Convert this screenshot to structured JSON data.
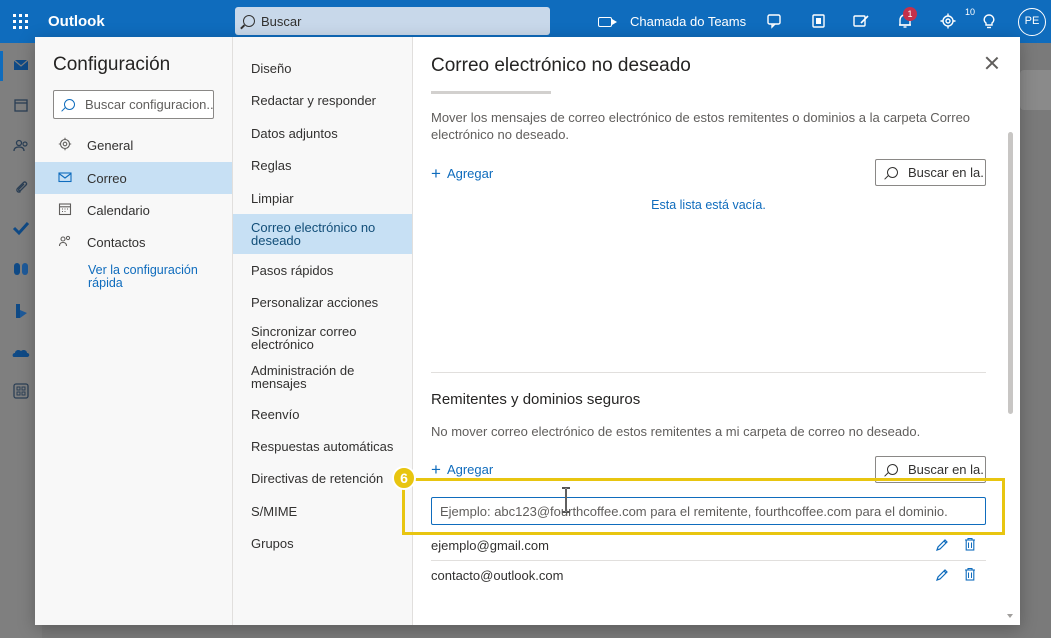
{
  "app": {
    "name": "Outlook",
    "search_placeholder": "Buscar",
    "teams_label": "Chamada do Teams",
    "notification_count": "1",
    "tips_count": "10",
    "avatar_initials": "PE"
  },
  "settings": {
    "title": "Configuración",
    "search_placeholder": "Buscar configuracion...",
    "categories": [
      {
        "label": "General",
        "icon": "gear-icon"
      },
      {
        "label": "Correo",
        "icon": "mail-icon"
      },
      {
        "label": "Calendario",
        "icon": "calendar-icon"
      },
      {
        "label": "Contactos",
        "icon": "people-icon"
      }
    ],
    "quick_link": "Ver la configuración rápida"
  },
  "mail_subsections": [
    "Diseño",
    "Redactar y responder",
    "Datos adjuntos",
    "Reglas",
    "Limpiar",
    "Correo electrónico no deseado",
    "Pasos rápidos",
    "Personalizar acciones",
    "Sincronizar correo electrónico",
    "Administración de mensajes",
    "Reenvío",
    "Respuestas automáticas",
    "Directivas de retención",
    "S/MIME",
    "Grupos"
  ],
  "pane": {
    "title": "Correo electrónico no deseado",
    "blocked": {
      "description": "Mover los mensajes de correo electrónico de estos remitentes o dominios a la carpeta Correo electrónico no deseado.",
      "add_label": "Agregar",
      "search_placeholder": "Buscar en la...",
      "empty_text": "Esta lista está vacía."
    },
    "safe": {
      "title": "Remitentes y dominios seguros",
      "description": "No mover correo electrónico de estos remitentes a mi carpeta de correo no deseado.",
      "add_label": "Agregar",
      "search_placeholder": "Buscar en la...",
      "input_placeholder": "Ejemplo: abc123@fourthcoffee.com para el remitente, fourthcoffee.com para el dominio.",
      "entries": [
        "ejemplo@gmail.com",
        "contacto@outlook.com"
      ]
    }
  },
  "annotation": {
    "step_number": "6",
    "highlight_color": "#e8c510"
  },
  "colors": {
    "brand": "#0f6cbd",
    "selected": "#c7e0f4"
  }
}
